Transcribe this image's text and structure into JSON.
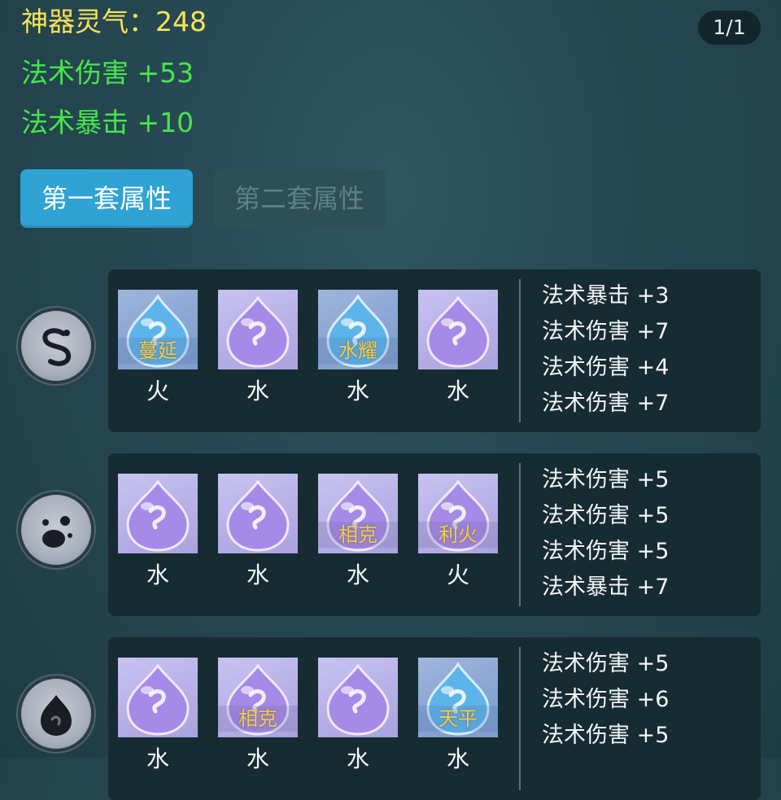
{
  "header": {
    "spirit_label": "神器灵气：248",
    "stat1": "法术伤害 +53",
    "stat2": "法术暴击 +10",
    "page_indicator": "1/1"
  },
  "tabs": [
    {
      "label": "第一套属性",
      "active": true
    },
    {
      "label": "第二套属性",
      "active": false
    }
  ],
  "colors": {
    "gold_text": "#f6e35a",
    "green_text": "#45e84a",
    "active_tab": "#2fa3d4",
    "gem_label": "#f2cc4a"
  },
  "groups": [
    {
      "emblem_icon": "swirl-icon",
      "slots": [
        {
          "gem": "blue",
          "gem_label": "蔓延",
          "element": "火"
        },
        {
          "gem": "purple",
          "gem_label": "",
          "element": "水"
        },
        {
          "gem": "blue",
          "gem_label": "水耀",
          "element": "水"
        },
        {
          "gem": "purple",
          "gem_label": "",
          "element": "水"
        }
      ],
      "attributes": [
        "法术暴击 +3",
        "法术伤害 +7",
        "法术伤害 +4",
        "法术伤害 +7"
      ]
    },
    {
      "emblem_icon": "ink-splash-icon",
      "slots": [
        {
          "gem": "purple",
          "gem_label": "",
          "element": "水"
        },
        {
          "gem": "purple",
          "gem_label": "",
          "element": "水"
        },
        {
          "gem": "purple",
          "gem_label": "相克",
          "element": "水"
        },
        {
          "gem": "purple",
          "gem_label": "利火",
          "element": "火"
        }
      ],
      "attributes": [
        "法术伤害 +5",
        "法术伤害 +5",
        "法术伤害 +5",
        "法术暴击 +7"
      ]
    },
    {
      "emblem_icon": "flame-drop-icon",
      "slots": [
        {
          "gem": "purple",
          "gem_label": "",
          "element": "水"
        },
        {
          "gem": "purple",
          "gem_label": "相克",
          "element": "水"
        },
        {
          "gem": "purple",
          "gem_label": "",
          "element": "水"
        },
        {
          "gem": "blue",
          "gem_label": "天平",
          "element": "水"
        }
      ],
      "attributes": [
        "法术伤害 +5",
        "法术伤害 +6",
        "法术伤害 +5"
      ]
    }
  ]
}
